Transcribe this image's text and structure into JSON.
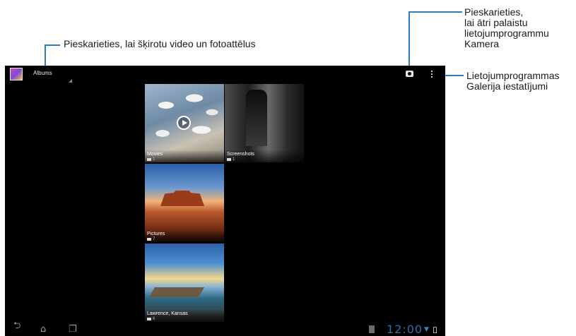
{
  "callouts": {
    "albums_desc": "Pieskarieties, lai šķirotu video un fotoattēlus",
    "camera_desc": "Pieskarieties,\nlai ātri palaistu\nlietojumprogrammu\nKamera",
    "menu_desc": "Lietojumprogrammas\nGalerija iestatījumi"
  },
  "actionbar": {
    "title": "Albums"
  },
  "albums": [
    {
      "title": "Movies",
      "count": "1"
    },
    {
      "title": "Screenshots",
      "count": "1"
    },
    {
      "title": "Pictures",
      "count": "7"
    },
    {
      "title": "Lawrence, Kansas",
      "count": "6"
    }
  ],
  "statusbar": {
    "time": "12:00"
  },
  "icons": [
    "app-icon",
    "camera-icon",
    "overflow-menu-icon",
    "play-icon",
    "folder-icon",
    "back-icon",
    "home-icon",
    "recent-apps-icon",
    "sd-card-icon",
    "wifi-icon",
    "battery-icon"
  ],
  "colors": {
    "accent": "#2c7dbf",
    "clock": "#2f6fa8",
    "screen_bg": "#000000"
  }
}
